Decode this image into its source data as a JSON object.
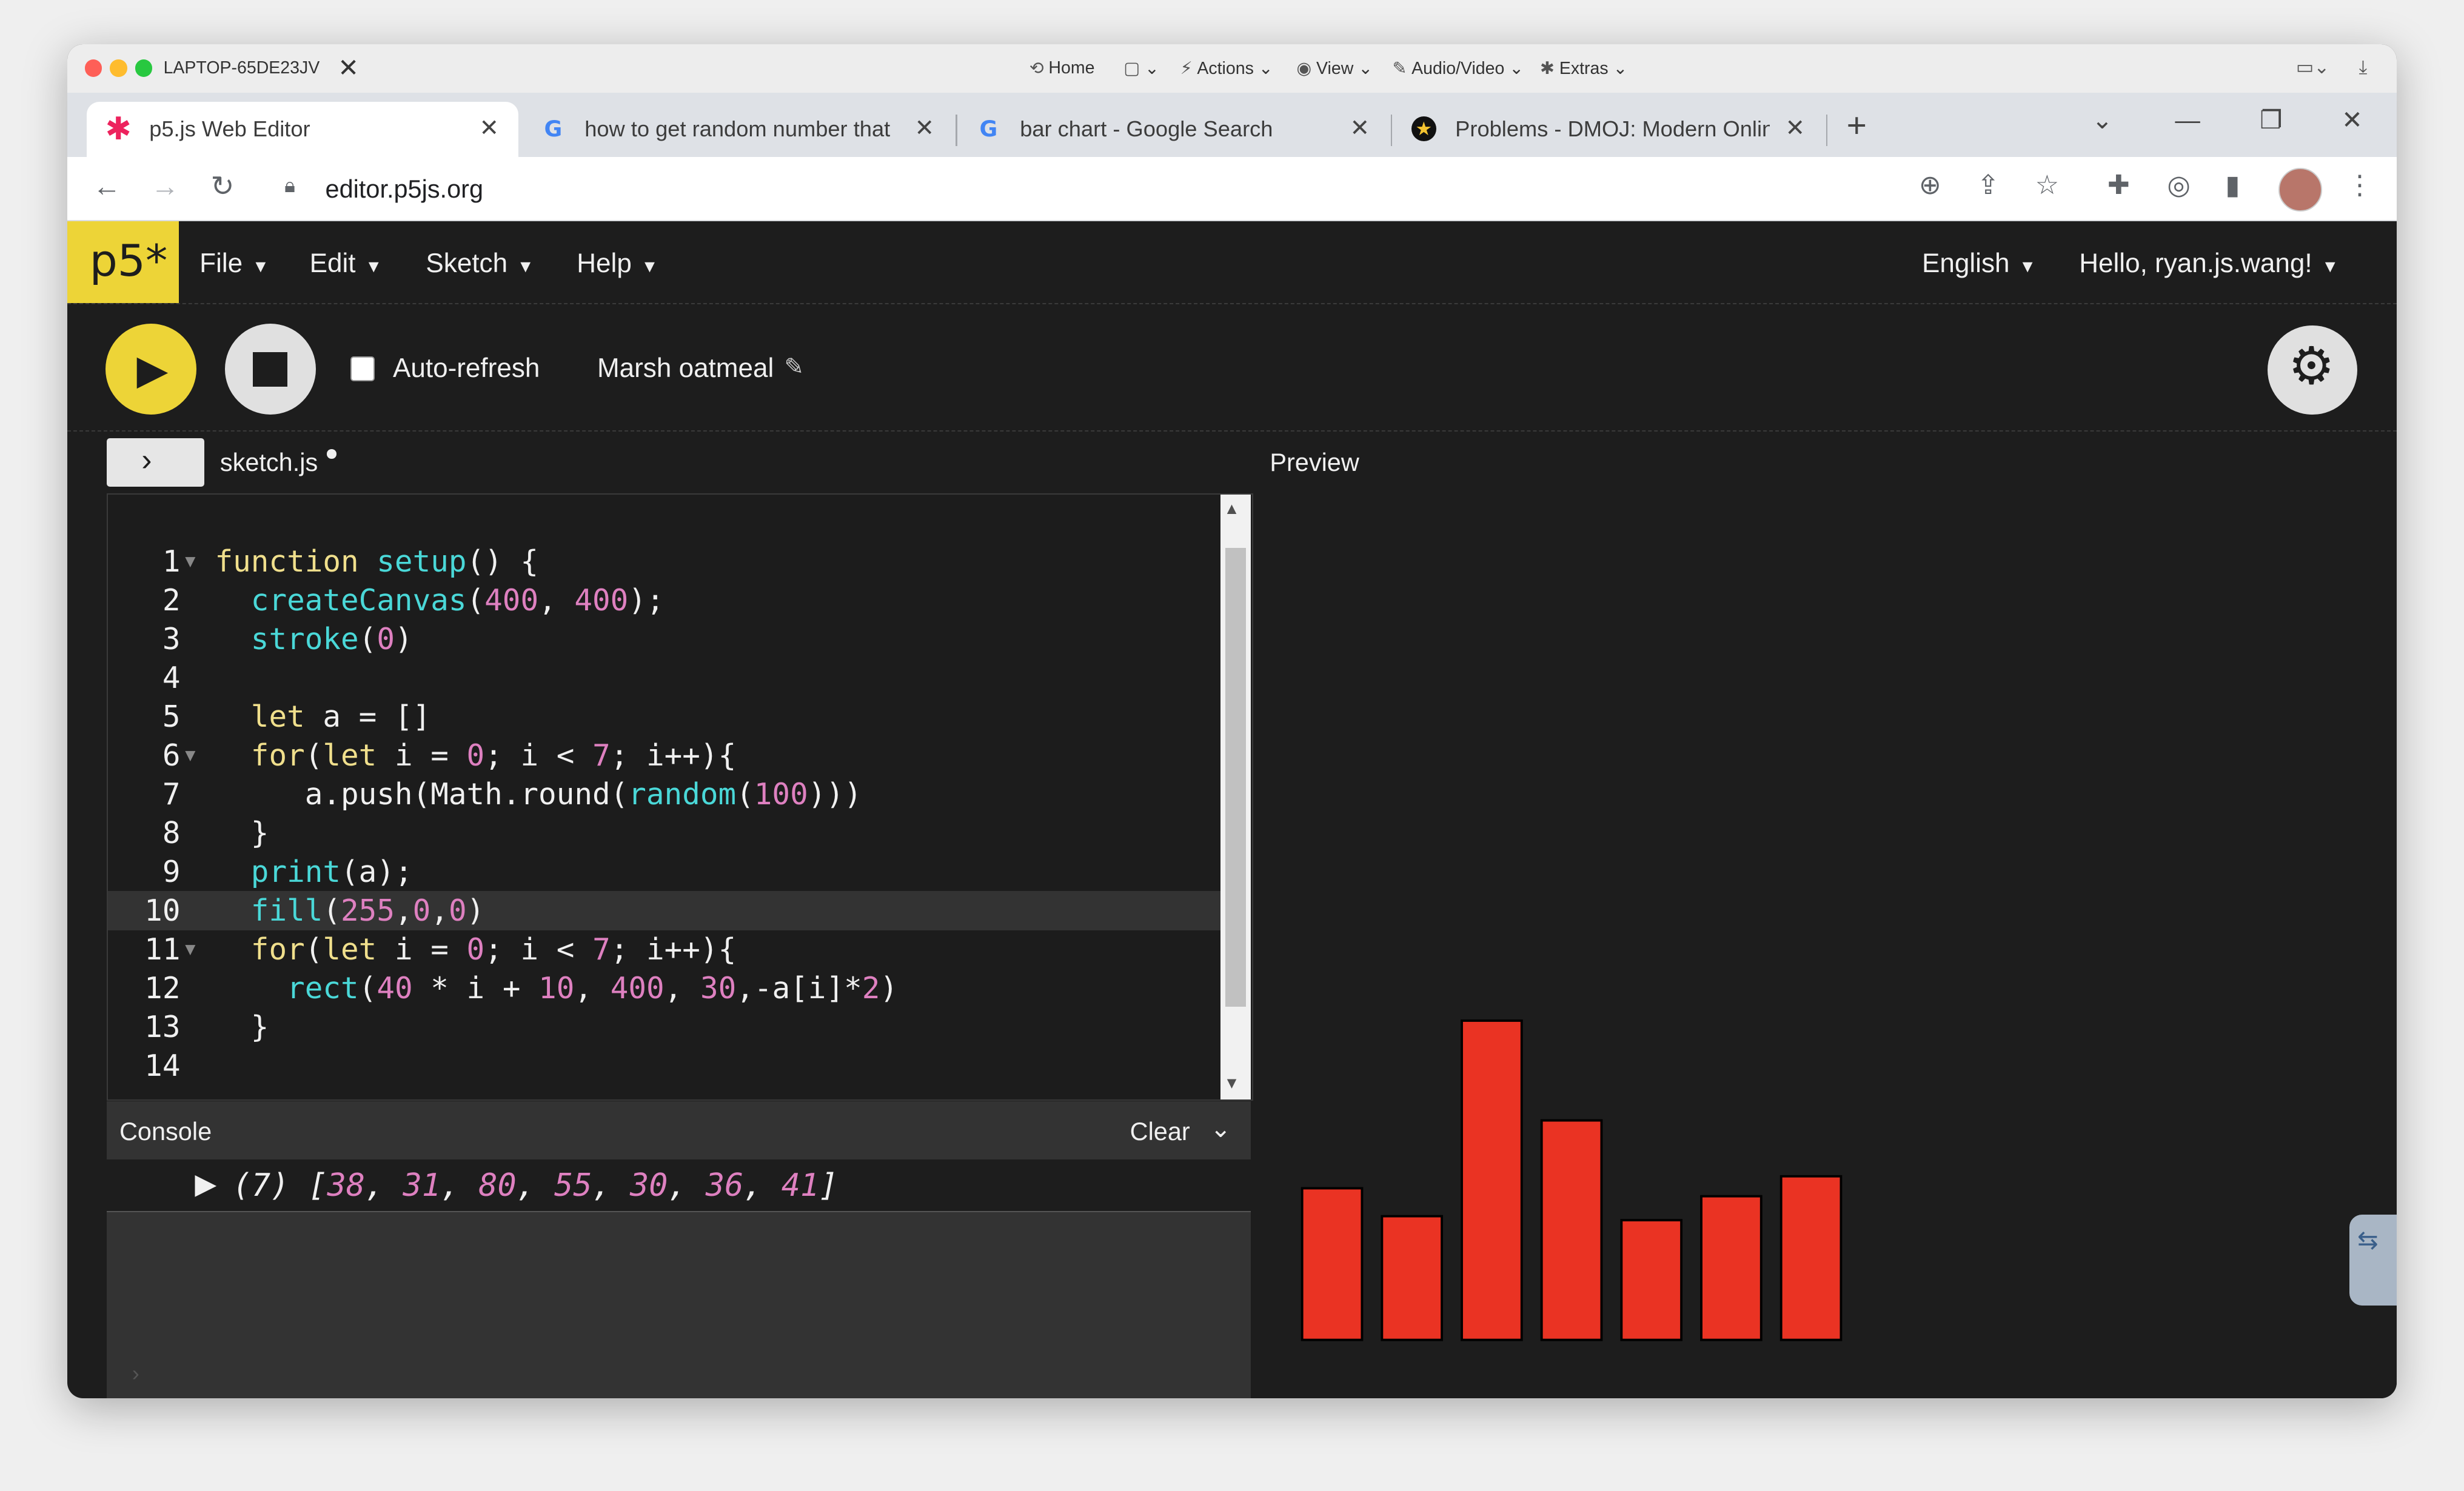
{
  "remote": {
    "host": "LAPTOP-65DE23JV",
    "menus": [
      {
        "icon": "⟲",
        "label": "Home",
        "caret": ""
      },
      {
        "icon": "▢",
        "label": "",
        "caret": "⌄"
      },
      {
        "icon": "⚡",
        "label": "Actions",
        "caret": "⌄"
      },
      {
        "icon": "◉",
        "label": "View",
        "caret": "⌄"
      },
      {
        "icon": "✎",
        "label": "Audio/Video",
        "caret": "⌄"
      },
      {
        "icon": "✱",
        "label": "Extras",
        "caret": "⌄"
      }
    ]
  },
  "tabs": [
    {
      "title": "p5.js Web Editor",
      "icon": "p5-star-icon",
      "active": true
    },
    {
      "title": "how to get random number that",
      "icon": "google-icon",
      "active": false
    },
    {
      "title": "bar chart - Google Search",
      "icon": "google-icon",
      "active": false
    },
    {
      "title": "Problems - DMOJ: Modern Onlin",
      "icon": "dmoj-icon",
      "active": false
    }
  ],
  "address": {
    "url": "editor.p5js.org"
  },
  "p5": {
    "logo": "p5*",
    "menus": [
      "File",
      "Edit",
      "Sketch",
      "Help"
    ],
    "language": "English",
    "user": "Hello, ryan.js.wang!"
  },
  "toolbar": {
    "auto_refresh_label": "Auto-refresh",
    "auto_refresh_checked": false,
    "sketch_name": "Marsh oatmeal"
  },
  "editor": {
    "filename": "sketch.js",
    "preview_label": "Preview",
    "current_line": 10,
    "lines": [
      {
        "n": "1",
        "fold": true,
        "tokens": [
          [
            "kw",
            "function "
          ],
          [
            "fn",
            "setup"
          ],
          [
            "",
            "() {"
          ]
        ]
      },
      {
        "n": "2",
        "fold": false,
        "tokens": [
          [
            "",
            "  "
          ],
          [
            "fn",
            "createCanvas"
          ],
          [
            "",
            "("
          ],
          [
            "num",
            "400"
          ],
          [
            "",
            ", "
          ],
          [
            "num",
            "400"
          ],
          [
            "",
            ");"
          ]
        ]
      },
      {
        "n": "3",
        "fold": false,
        "tokens": [
          [
            "",
            "  "
          ],
          [
            "fn",
            "stroke"
          ],
          [
            "",
            "("
          ],
          [
            "num",
            "0"
          ],
          [
            "",
            ")"
          ]
        ]
      },
      {
        "n": "4",
        "fold": false,
        "tokens": []
      },
      {
        "n": "5",
        "fold": false,
        "tokens": [
          [
            "",
            "  "
          ],
          [
            "kw",
            "let "
          ],
          [
            "",
            "a = []"
          ]
        ]
      },
      {
        "n": "6",
        "fold": true,
        "tokens": [
          [
            "",
            "  "
          ],
          [
            "kw",
            "for"
          ],
          [
            "",
            "("
          ],
          [
            "kw",
            "let "
          ],
          [
            "",
            "i = "
          ],
          [
            "num",
            "0"
          ],
          [
            "",
            "; i < "
          ],
          [
            "num",
            "7"
          ],
          [
            "",
            "; i++){"
          ]
        ]
      },
      {
        "n": "7",
        "fold": false,
        "tokens": [
          [
            "",
            "     a.push(Math.round("
          ],
          [
            "fn",
            "random"
          ],
          [
            "",
            "("
          ],
          [
            "num",
            "100"
          ],
          [
            "",
            ")))"
          ]
        ]
      },
      {
        "n": "8",
        "fold": false,
        "tokens": [
          [
            "",
            "  }"
          ]
        ]
      },
      {
        "n": "9",
        "fold": false,
        "tokens": [
          [
            "",
            "  "
          ],
          [
            "fn",
            "print"
          ],
          [
            "",
            "(a);"
          ]
        ]
      },
      {
        "n": "10",
        "fold": false,
        "tokens": [
          [
            "",
            "  "
          ],
          [
            "fn",
            "fill"
          ],
          [
            "",
            "("
          ],
          [
            "num",
            "255"
          ],
          [
            "",
            ","
          ],
          [
            "num",
            "0"
          ],
          [
            "",
            ","
          ],
          [
            "num",
            "0"
          ],
          [
            "",
            ")"
          ]
        ]
      },
      {
        "n": "11",
        "fold": true,
        "tokens": [
          [
            "",
            "  "
          ],
          [
            "kw",
            "for"
          ],
          [
            "",
            "("
          ],
          [
            "kw",
            "let "
          ],
          [
            "",
            "i = "
          ],
          [
            "num",
            "0"
          ],
          [
            "",
            "; i < "
          ],
          [
            "num",
            "7"
          ],
          [
            "",
            "; i++){"
          ]
        ]
      },
      {
        "n": "12",
        "fold": false,
        "tokens": [
          [
            "",
            "    "
          ],
          [
            "fn",
            "rect"
          ],
          [
            "",
            "("
          ],
          [
            "num",
            "40"
          ],
          [
            "",
            " * i + "
          ],
          [
            "num",
            "10"
          ],
          [
            "",
            ", "
          ],
          [
            "num",
            "400"
          ],
          [
            "",
            ", "
          ],
          [
            "num",
            "30"
          ],
          [
            "",
            ",-a[i]*"
          ],
          [
            "num",
            "2"
          ],
          [
            "",
            ")"
          ]
        ]
      },
      {
        "n": "13",
        "fold": false,
        "tokens": [
          [
            "",
            "  }"
          ]
        ]
      },
      {
        "n": "14",
        "fold": false,
        "tokens": []
      }
    ]
  },
  "console": {
    "title": "Console",
    "clear_label": "Clear",
    "count": "(7)",
    "values": [
      38,
      31,
      80,
      55,
      30,
      36,
      41
    ]
  },
  "preview": {
    "canvas_size": 400,
    "fill_color": "#ff0000",
    "stroke_color": "#000000"
  },
  "colors": {
    "p5_yellow": "#edd437",
    "editor_bg": "#1d1d1d",
    "keyword": "#f0df8c",
    "function": "#4ad8d8",
    "number": "#de80c0"
  }
}
